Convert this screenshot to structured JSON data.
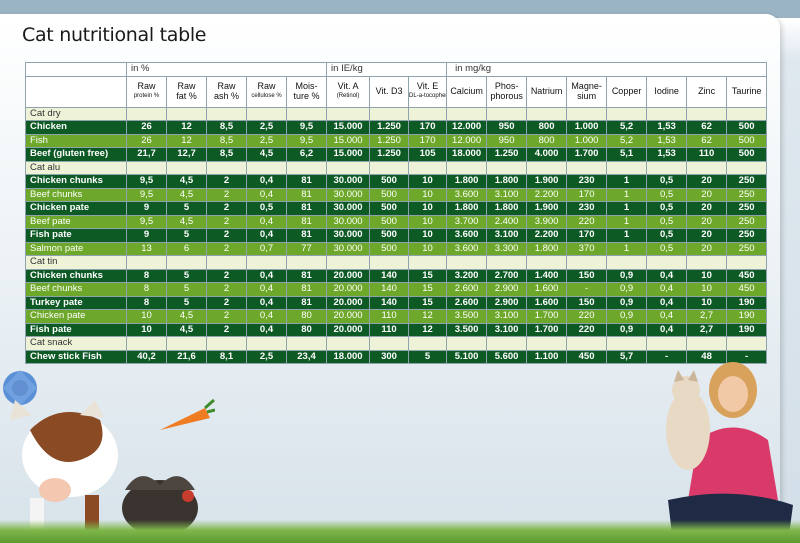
{
  "title": "Cat nutritional table",
  "groups": [
    "in %",
    "in IE/kg",
    "in mg/kg"
  ],
  "columns": [
    {
      "main": "Raw",
      "sub": "protein %"
    },
    {
      "main": "Raw",
      "sub": "fat %"
    },
    {
      "main": "Raw",
      "sub": "ash %"
    },
    {
      "main": "Raw",
      "sub": "cellulose %"
    },
    {
      "main": "Mois-",
      "sub": "ture %"
    },
    {
      "main": "Vit. A",
      "sub": "(Retinol)"
    },
    {
      "main": "Vit. D3",
      "sub": ""
    },
    {
      "main": "Vit. E",
      "sub": "DL-a-tocopherol"
    },
    {
      "main": "Calcium",
      "sub": ""
    },
    {
      "main": "Phos-",
      "sub": "phorous"
    },
    {
      "main": "Natrium",
      "sub": ""
    },
    {
      "main": "Magne-",
      "sub": "sium"
    },
    {
      "main": "Copper",
      "sub": ""
    },
    {
      "main": "Iodine",
      "sub": ""
    },
    {
      "main": "Zinc",
      "sub": ""
    },
    {
      "main": "Taurine",
      "sub": ""
    }
  ],
  "sections": [
    {
      "name": "Cat dry",
      "rows": [
        {
          "name": "Chicken",
          "style": "dark",
          "values": [
            "26",
            "12",
            "8,5",
            "2,5",
            "9,5",
            "15.000",
            "1.250",
            "170",
            "12.000",
            "950",
            "800",
            "1.000",
            "5,2",
            "1,53",
            "62",
            "500"
          ]
        },
        {
          "name": "Fish",
          "style": "light",
          "values": [
            "26",
            "12",
            "8,5",
            "2,5",
            "9,5",
            "15.000",
            "1.250",
            "170",
            "12.000",
            "950",
            "800",
            "1.000",
            "5,2",
            "1,53",
            "62",
            "500"
          ]
        },
        {
          "name": "Beef (gluten free)",
          "style": "dark",
          "values": [
            "21,7",
            "12,7",
            "8,5",
            "4,5",
            "6,2",
            "15.000",
            "1.250",
            "105",
            "18.000",
            "1.250",
            "4.000",
            "1.700",
            "5,1",
            "1,53",
            "110",
            "500"
          ]
        }
      ]
    },
    {
      "name": "Cat alu",
      "rows": [
        {
          "name": "Chicken chunks",
          "style": "dark",
          "values": [
            "9,5",
            "4,5",
            "2",
            "0,4",
            "81",
            "30.000",
            "500",
            "10",
            "1.800",
            "1.800",
            "1.900",
            "230",
            "1",
            "0,5",
            "20",
            "250"
          ]
        },
        {
          "name": "Beef chunks",
          "style": "light",
          "values": [
            "9,5",
            "4,5",
            "2",
            "0,4",
            "81",
            "30.000",
            "500",
            "10",
            "3.600",
            "3.100",
            "2.200",
            "170",
            "1",
            "0,5",
            "20",
            "250"
          ]
        },
        {
          "name": "Chicken pate",
          "style": "dark",
          "values": [
            "9",
            "5",
            "2",
            "0,5",
            "81",
            "30.000",
            "500",
            "10",
            "1.800",
            "1.800",
            "1.900",
            "230",
            "1",
            "0,5",
            "20",
            "250"
          ]
        },
        {
          "name": "Beef pate",
          "style": "light",
          "values": [
            "9,5",
            "4,5",
            "2",
            "0,4",
            "81",
            "30.000",
            "500",
            "10",
            "3.700",
            "2.400",
            "3.900",
            "220",
            "1",
            "0,5",
            "20",
            "250"
          ]
        },
        {
          "name": "Fish pate",
          "style": "dark",
          "values": [
            "9",
            "5",
            "2",
            "0,4",
            "81",
            "30.000",
            "500",
            "10",
            "3.600",
            "3.100",
            "2.200",
            "170",
            "1",
            "0,5",
            "20",
            "250"
          ]
        },
        {
          "name": "Salmon pate",
          "style": "light",
          "values": [
            "13",
            "6",
            "2",
            "0,7",
            "77",
            "30.000",
            "500",
            "10",
            "3.600",
            "3.300",
            "1.800",
            "370",
            "1",
            "0,5",
            "20",
            "250"
          ]
        }
      ]
    },
    {
      "name": "Cat tin",
      "rows": [
        {
          "name": "Chicken chunks",
          "style": "dark",
          "values": [
            "8",
            "5",
            "2",
            "0,4",
            "81",
            "20.000",
            "140",
            "15",
            "3.200",
            "2.700",
            "1.400",
            "150",
            "0,9",
            "0,4",
            "10",
            "450"
          ]
        },
        {
          "name": "Beef chunks",
          "style": "light",
          "values": [
            "8",
            "5",
            "2",
            "0,4",
            "81",
            "20.000",
            "140",
            "15",
            "2.600",
            "2.900",
            "1.600",
            "-",
            "0,9",
            "0,4",
            "10",
            "450"
          ]
        },
        {
          "name": "Turkey pate",
          "style": "dark",
          "values": [
            "8",
            "5",
            "2",
            "0,4",
            "81",
            "20.000",
            "140",
            "15",
            "2.600",
            "2.900",
            "1.600",
            "150",
            "0,9",
            "0,4",
            "10",
            "190"
          ]
        },
        {
          "name": "Chicken pate",
          "style": "light",
          "values": [
            "10",
            "4,5",
            "2",
            "0,4",
            "80",
            "20.000",
            "110",
            "12",
            "3.500",
            "3.100",
            "1.700",
            "220",
            "0,9",
            "0,4",
            "2,7",
            "190"
          ]
        },
        {
          "name": "Fish pate",
          "style": "dark",
          "values": [
            "10",
            "4,5",
            "2",
            "0,4",
            "80",
            "20.000",
            "110",
            "12",
            "3.500",
            "3.100",
            "1.700",
            "220",
            "0,9",
            "0,4",
            "2,7",
            "190"
          ]
        }
      ]
    },
    {
      "name": "Cat snack",
      "rows": [
        {
          "name": "Chew stick Fish",
          "style": "dark",
          "values": [
            "40,2",
            "21,6",
            "8,1",
            "2,5",
            "23,4",
            "18.000",
            "300",
            "5",
            "5.100",
            "5.600",
            "1.100",
            "450",
            "5,7",
            "-",
            "48",
            "-"
          ]
        }
      ]
    }
  ],
  "illustrations": [
    "cow",
    "cornflower",
    "carrot",
    "turkey",
    "woman-holding-cat",
    "grass"
  ],
  "colors": {
    "dark_row": "#0d5a25",
    "light_row": "#6ea82a",
    "category_row": "#eef3d8",
    "background": "#d9e3ea"
  }
}
